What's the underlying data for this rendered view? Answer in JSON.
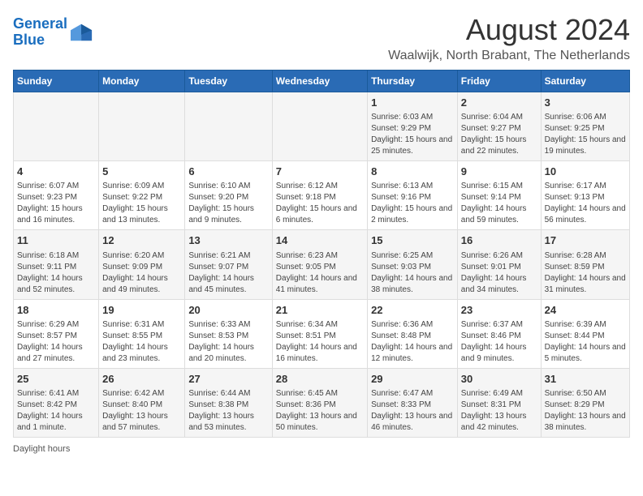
{
  "logo": {
    "text_general": "General",
    "text_blue": "Blue"
  },
  "title": "August 2024",
  "subtitle": "Waalwijk, North Brabant, The Netherlands",
  "days_of_week": [
    "Sunday",
    "Monday",
    "Tuesday",
    "Wednesday",
    "Thursday",
    "Friday",
    "Saturday"
  ],
  "weeks": [
    [
      {
        "day": "",
        "sunrise": "",
        "sunset": "",
        "daylight": ""
      },
      {
        "day": "",
        "sunrise": "",
        "sunset": "",
        "daylight": ""
      },
      {
        "day": "",
        "sunrise": "",
        "sunset": "",
        "daylight": ""
      },
      {
        "day": "",
        "sunrise": "",
        "sunset": "",
        "daylight": ""
      },
      {
        "day": "1",
        "sunrise": "Sunrise: 6:03 AM",
        "sunset": "Sunset: 9:29 PM",
        "daylight": "Daylight: 15 hours and 25 minutes."
      },
      {
        "day": "2",
        "sunrise": "Sunrise: 6:04 AM",
        "sunset": "Sunset: 9:27 PM",
        "daylight": "Daylight: 15 hours and 22 minutes."
      },
      {
        "day": "3",
        "sunrise": "Sunrise: 6:06 AM",
        "sunset": "Sunset: 9:25 PM",
        "daylight": "Daylight: 15 hours and 19 minutes."
      }
    ],
    [
      {
        "day": "4",
        "sunrise": "Sunrise: 6:07 AM",
        "sunset": "Sunset: 9:23 PM",
        "daylight": "Daylight: 15 hours and 16 minutes."
      },
      {
        "day": "5",
        "sunrise": "Sunrise: 6:09 AM",
        "sunset": "Sunset: 9:22 PM",
        "daylight": "Daylight: 15 hours and 13 minutes."
      },
      {
        "day": "6",
        "sunrise": "Sunrise: 6:10 AM",
        "sunset": "Sunset: 9:20 PM",
        "daylight": "Daylight: 15 hours and 9 minutes."
      },
      {
        "day": "7",
        "sunrise": "Sunrise: 6:12 AM",
        "sunset": "Sunset: 9:18 PM",
        "daylight": "Daylight: 15 hours and 6 minutes."
      },
      {
        "day": "8",
        "sunrise": "Sunrise: 6:13 AM",
        "sunset": "Sunset: 9:16 PM",
        "daylight": "Daylight: 15 hours and 2 minutes."
      },
      {
        "day": "9",
        "sunrise": "Sunrise: 6:15 AM",
        "sunset": "Sunset: 9:14 PM",
        "daylight": "Daylight: 14 hours and 59 minutes."
      },
      {
        "day": "10",
        "sunrise": "Sunrise: 6:17 AM",
        "sunset": "Sunset: 9:13 PM",
        "daylight": "Daylight: 14 hours and 56 minutes."
      }
    ],
    [
      {
        "day": "11",
        "sunrise": "Sunrise: 6:18 AM",
        "sunset": "Sunset: 9:11 PM",
        "daylight": "Daylight: 14 hours and 52 minutes."
      },
      {
        "day": "12",
        "sunrise": "Sunrise: 6:20 AM",
        "sunset": "Sunset: 9:09 PM",
        "daylight": "Daylight: 14 hours and 49 minutes."
      },
      {
        "day": "13",
        "sunrise": "Sunrise: 6:21 AM",
        "sunset": "Sunset: 9:07 PM",
        "daylight": "Daylight: 14 hours and 45 minutes."
      },
      {
        "day": "14",
        "sunrise": "Sunrise: 6:23 AM",
        "sunset": "Sunset: 9:05 PM",
        "daylight": "Daylight: 14 hours and 41 minutes."
      },
      {
        "day": "15",
        "sunrise": "Sunrise: 6:25 AM",
        "sunset": "Sunset: 9:03 PM",
        "daylight": "Daylight: 14 hours and 38 minutes."
      },
      {
        "day": "16",
        "sunrise": "Sunrise: 6:26 AM",
        "sunset": "Sunset: 9:01 PM",
        "daylight": "Daylight: 14 hours and 34 minutes."
      },
      {
        "day": "17",
        "sunrise": "Sunrise: 6:28 AM",
        "sunset": "Sunset: 8:59 PM",
        "daylight": "Daylight: 14 hours and 31 minutes."
      }
    ],
    [
      {
        "day": "18",
        "sunrise": "Sunrise: 6:29 AM",
        "sunset": "Sunset: 8:57 PM",
        "daylight": "Daylight: 14 hours and 27 minutes."
      },
      {
        "day": "19",
        "sunrise": "Sunrise: 6:31 AM",
        "sunset": "Sunset: 8:55 PM",
        "daylight": "Daylight: 14 hours and 23 minutes."
      },
      {
        "day": "20",
        "sunrise": "Sunrise: 6:33 AM",
        "sunset": "Sunset: 8:53 PM",
        "daylight": "Daylight: 14 hours and 20 minutes."
      },
      {
        "day": "21",
        "sunrise": "Sunrise: 6:34 AM",
        "sunset": "Sunset: 8:51 PM",
        "daylight": "Daylight: 14 hours and 16 minutes."
      },
      {
        "day": "22",
        "sunrise": "Sunrise: 6:36 AM",
        "sunset": "Sunset: 8:48 PM",
        "daylight": "Daylight: 14 hours and 12 minutes."
      },
      {
        "day": "23",
        "sunrise": "Sunrise: 6:37 AM",
        "sunset": "Sunset: 8:46 PM",
        "daylight": "Daylight: 14 hours and 9 minutes."
      },
      {
        "day": "24",
        "sunrise": "Sunrise: 6:39 AM",
        "sunset": "Sunset: 8:44 PM",
        "daylight": "Daylight: 14 hours and 5 minutes."
      }
    ],
    [
      {
        "day": "25",
        "sunrise": "Sunrise: 6:41 AM",
        "sunset": "Sunset: 8:42 PM",
        "daylight": "Daylight: 14 hours and 1 minute."
      },
      {
        "day": "26",
        "sunrise": "Sunrise: 6:42 AM",
        "sunset": "Sunset: 8:40 PM",
        "daylight": "Daylight: 13 hours and 57 minutes."
      },
      {
        "day": "27",
        "sunrise": "Sunrise: 6:44 AM",
        "sunset": "Sunset: 8:38 PM",
        "daylight": "Daylight: 13 hours and 53 minutes."
      },
      {
        "day": "28",
        "sunrise": "Sunrise: 6:45 AM",
        "sunset": "Sunset: 8:36 PM",
        "daylight": "Daylight: 13 hours and 50 minutes."
      },
      {
        "day": "29",
        "sunrise": "Sunrise: 6:47 AM",
        "sunset": "Sunset: 8:33 PM",
        "daylight": "Daylight: 13 hours and 46 minutes."
      },
      {
        "day": "30",
        "sunrise": "Sunrise: 6:49 AM",
        "sunset": "Sunset: 8:31 PM",
        "daylight": "Daylight: 13 hours and 42 minutes."
      },
      {
        "day": "31",
        "sunrise": "Sunrise: 6:50 AM",
        "sunset": "Sunset: 8:29 PM",
        "daylight": "Daylight: 13 hours and 38 minutes."
      }
    ]
  ],
  "footer": {
    "daylight_label": "Daylight hours"
  }
}
